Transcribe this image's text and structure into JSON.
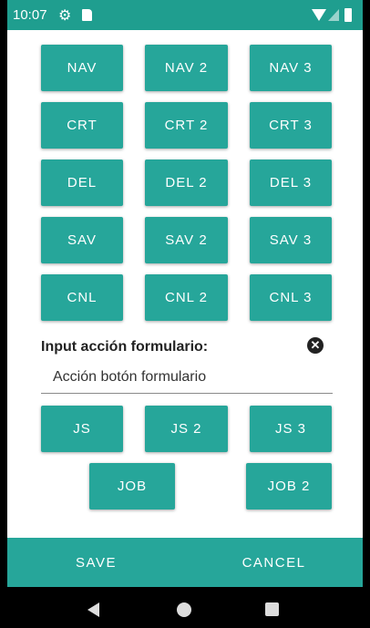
{
  "status_bar": {
    "time": "10:07",
    "icons": [
      "gear-icon",
      "sd-card-icon",
      "wifi-icon",
      "signal-icon",
      "battery-icon"
    ]
  },
  "buttons": {
    "nav": "NAV",
    "nav2": "NAV 2",
    "nav3": "NAV 3",
    "crt": "CRT",
    "crt2": "CRT 2",
    "crt3": "CRT 3",
    "del": "DEL",
    "del2": "DEL 2",
    "del3": "DEL 3",
    "sav": "SAV",
    "sav2": "SAV 2",
    "sav3": "SAV 3",
    "cnl": "CNL",
    "cnl2": "CNL 2",
    "cnl3": "CNL 3",
    "js": "JS",
    "js2": "JS 2",
    "js3": "JS 3",
    "job": "JOB",
    "job2": "JOB 2"
  },
  "form": {
    "label": "Input acción formulario:",
    "value": "Acción botón formulario"
  },
  "bottom_bar": {
    "save": "SAVE",
    "cancel": "CANCEL"
  },
  "colors": {
    "accent": "#26a69a",
    "status_bar": "#1f9e8f"
  }
}
